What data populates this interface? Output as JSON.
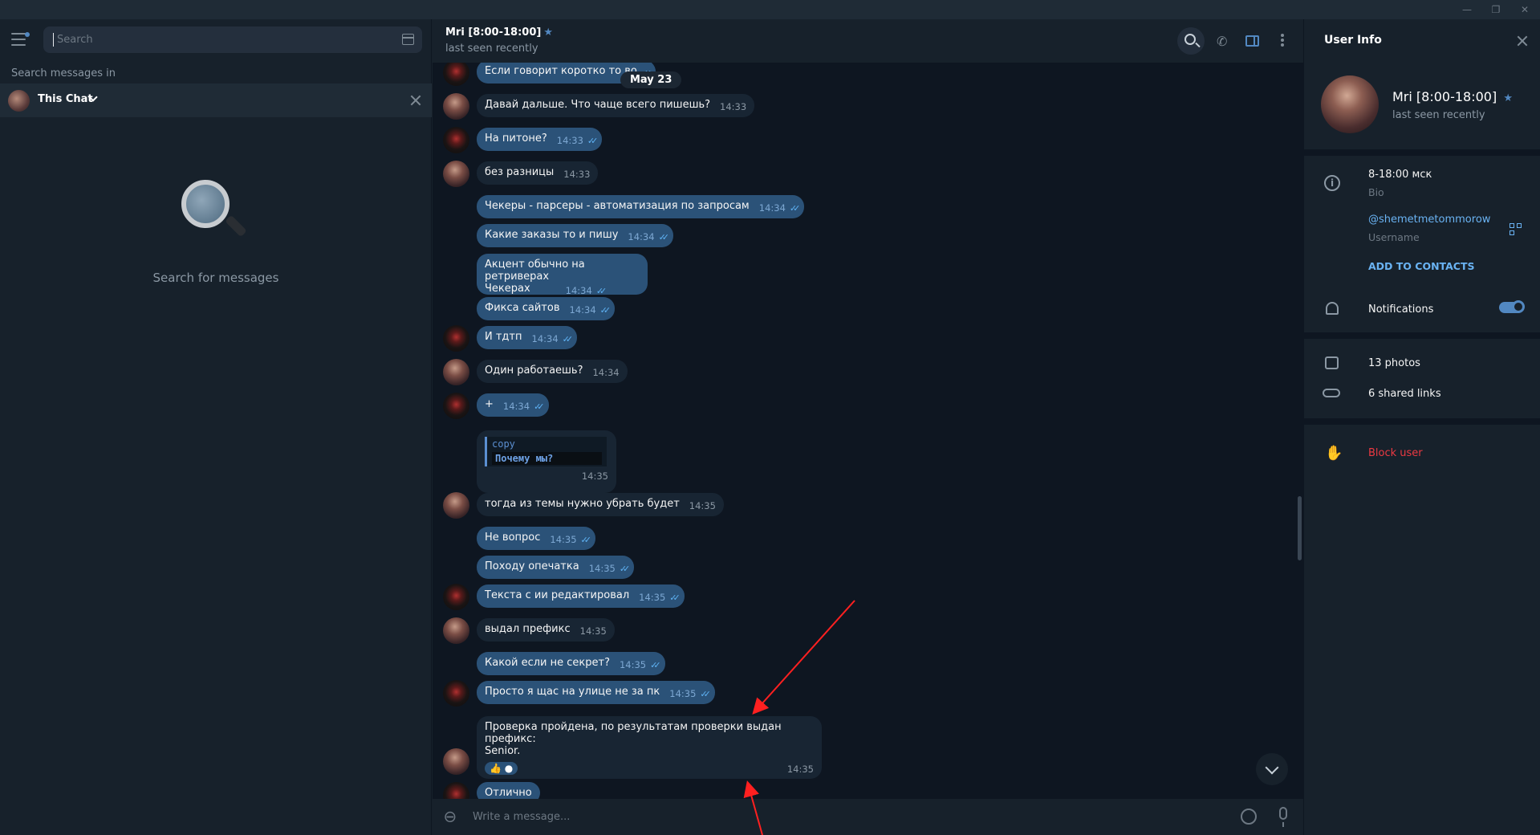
{
  "window": {
    "controls": [
      "—",
      "❐",
      "✕"
    ]
  },
  "left": {
    "search_placeholder": "Search",
    "search_in_label": "Search messages in",
    "chat_scope": "This Chat",
    "empty_text": "Search for messages"
  },
  "chat": {
    "title": "Mri [8:00-18:00]",
    "status": "last seen recently",
    "date_pill": "May 23",
    "composer_placeholder": "Write a message...",
    "messages": [
      {
        "dir": "in_top",
        "text": "Если говорит коротко то во",
        "time": ""
      },
      {
        "dir": "in",
        "text": "Давай дальше. Что чаще всего пишешь?",
        "time": "14:33"
      },
      {
        "dir": "out",
        "text": "На питоне?",
        "time": "14:33"
      },
      {
        "dir": "in",
        "text": "без разницы",
        "time": "14:33"
      },
      {
        "dir": "out",
        "text": "Чекеры - парсеры - автоматизация по запросам",
        "time": "14:34"
      },
      {
        "dir": "out",
        "text": "Какие заказы то и пишу",
        "time": "14:34"
      },
      {
        "dir": "out",
        "text": "Акцент обычно на ретриверах",
        "text2": "Чекерах",
        "time": "14:34"
      },
      {
        "dir": "out",
        "text": "Фикса сайтов",
        "time": "14:34"
      },
      {
        "dir": "out",
        "text": "И тдтп",
        "time": "14:34"
      },
      {
        "dir": "in",
        "text": "Один работаешь?",
        "time": "14:34"
      },
      {
        "dir": "out",
        "text": "+",
        "time": "14:34"
      },
      {
        "dir": "in_code",
        "lang": "copy",
        "code": "Почему мы?",
        "time": "14:35"
      },
      {
        "dir": "in",
        "text": "тогда из темы нужно убрать будет",
        "time": "14:35"
      },
      {
        "dir": "out",
        "text": "Не вопрос",
        "time": "14:35"
      },
      {
        "dir": "out",
        "text": "Походу опечатка",
        "time": "14:35"
      },
      {
        "dir": "out",
        "text": "Текста с ии редактировал",
        "time": "14:35"
      },
      {
        "dir": "in",
        "text": "выдал префикс",
        "time": "14:35"
      },
      {
        "dir": "out",
        "text": "Какой если не секрет?",
        "time": "14:35"
      },
      {
        "dir": "out",
        "text": "Просто я щас на улице не за пк",
        "time": "14:35"
      },
      {
        "dir": "in_reaction",
        "text": "Проверка пройдена, по результатам проверки выдан префикс:",
        "text2": "Senior.",
        "reaction": "👍",
        "time": "14:35"
      },
      {
        "dir": "out",
        "text": "Отлично",
        "time": ""
      }
    ]
  },
  "user_info": {
    "title": "User Info",
    "name": "Mri [8:00-18:00]",
    "status": "last seen recently",
    "bio": "8-18:00 мск",
    "bio_label": "Bio",
    "username": "@shemetmetommorow",
    "username_label": "Username",
    "add_contacts": "ADD TO CONTACTS",
    "notifications": "Notifications",
    "notifications_on": true,
    "photos": "13 photos",
    "links": "6 shared links",
    "block": "Block user"
  },
  "colors": {
    "accent": "#5288c1",
    "out_bubble": "#2b5278",
    "in_bubble": "#182533",
    "danger": "#ec3942",
    "annotation_arrow": "#ff2020"
  }
}
